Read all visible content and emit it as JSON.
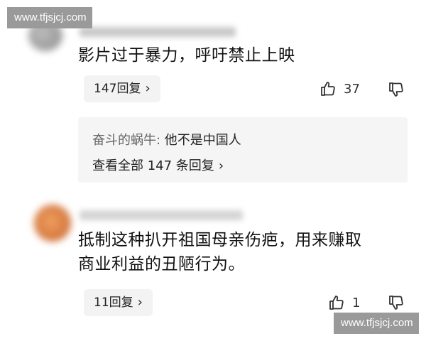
{
  "watermark": {
    "text": "www.tfjsjcj.com"
  },
  "comment1": {
    "text": "影片过于暴力，呼吁禁止上映",
    "reply_button": "147回复",
    "like_count": "37",
    "nested_reply": {
      "author": "奋斗的蜗牛:",
      "text": " 他不是中国人",
      "view_all": "查看全部 147 条回复"
    }
  },
  "comment2": {
    "text_line1": "抵制这种扒开祖国母亲伤疤，用来赚取",
    "text_line2": "商业利益的丑陋行为。",
    "reply_button": "11回复",
    "like_count": "1"
  },
  "icons": {
    "like": "thumbs-up-icon",
    "dislike": "thumbs-down-icon",
    "chevron": "chevron-right-icon"
  },
  "colors": {
    "watermark_bg": "#9a9a9a",
    "reply_box_bg": "#f5f5f5",
    "pill_bg": "#f3f3f3"
  }
}
